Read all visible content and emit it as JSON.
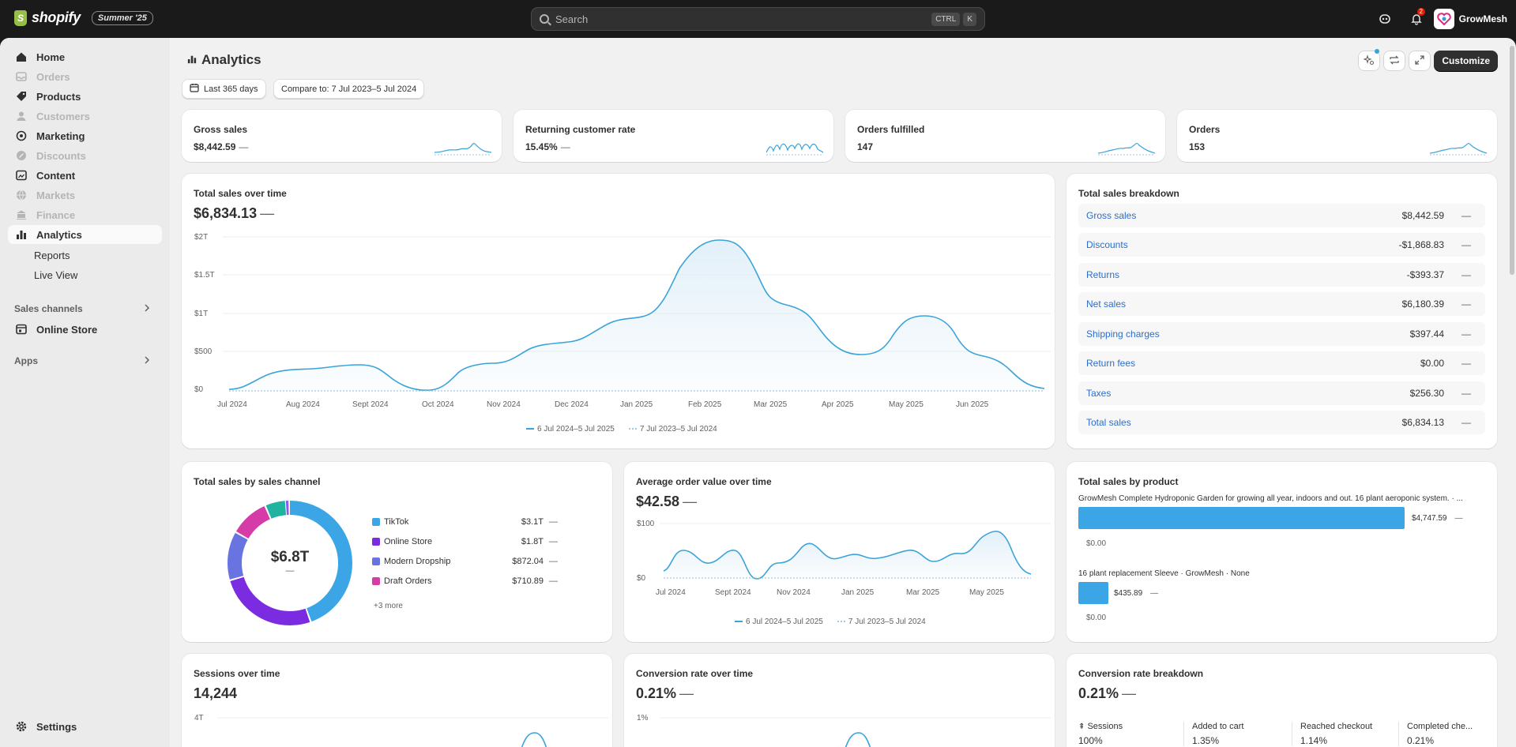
{
  "topbar": {
    "brand": "shopify",
    "edition": "Summer '25",
    "search_placeholder": "Search",
    "shortcut_ctrl": "CTRL",
    "shortcut_key": "K",
    "notifications_count": "2",
    "store_name": "GrowMesh"
  },
  "sidebar": {
    "items": [
      {
        "label": "Home",
        "icon": "home-icon",
        "enabled": true
      },
      {
        "label": "Orders",
        "icon": "orders-icon",
        "enabled": false
      },
      {
        "label": "Products",
        "icon": "tag-icon",
        "enabled": true
      },
      {
        "label": "Customers",
        "icon": "person-icon",
        "enabled": false
      },
      {
        "label": "Marketing",
        "icon": "target-icon",
        "enabled": true
      },
      {
        "label": "Discounts",
        "icon": "discount-icon",
        "enabled": false
      },
      {
        "label": "Content",
        "icon": "content-icon",
        "enabled": true
      },
      {
        "label": "Markets",
        "icon": "globe-icon",
        "enabled": false
      },
      {
        "label": "Finance",
        "icon": "bank-icon",
        "enabled": false
      },
      {
        "label": "Analytics",
        "icon": "chart-icon",
        "enabled": true
      }
    ],
    "sub_items": [
      "Reports",
      "Live View"
    ],
    "sales_channels_label": "Sales channels",
    "online_store_label": "Online Store",
    "apps_label": "Apps",
    "settings_label": "Settings"
  },
  "header": {
    "title": "Analytics",
    "date_range": "Last 365 days",
    "compare": "Compare to: 7 Jul 2023–5 Jul 2024",
    "customize_label": "Customize"
  },
  "kpis": [
    {
      "title": "Gross sales",
      "value": "$8,442.59",
      "delta": "—"
    },
    {
      "title": "Returning customer rate",
      "value": "15.45%",
      "delta": "—"
    },
    {
      "title": "Orders fulfilled",
      "value": "147",
      "delta": "—"
    },
    {
      "title": "Orders",
      "value": "153",
      "delta": "—"
    }
  ],
  "total_sales_over_time": {
    "title": "Total sales over time",
    "value": "$6,834.13",
    "delta": "—",
    "legend_current": "6 Jul 2024–5 Jul 2025",
    "legend_previous": "7 Jul 2023–5 Jul 2024",
    "y_ticks": [
      "$2T",
      "$1.5T",
      "$1T",
      "$500",
      "$0"
    ],
    "x_ticks": [
      "Jul 2024",
      "Aug 2024",
      "Sept 2024",
      "Oct 2024",
      "Nov 2024",
      "Dec 2024",
      "Jan 2025",
      "Feb 2025",
      "Mar 2025",
      "Apr 2025",
      "May 2025",
      "Jun 2025"
    ]
  },
  "breakdown": {
    "title": "Total sales breakdown",
    "rows": [
      {
        "label": "Gross sales",
        "value": "$8,442.59",
        "delta": "—"
      },
      {
        "label": "Discounts",
        "value": "-$1,868.83",
        "delta": "—"
      },
      {
        "label": "Returns",
        "value": "-$393.37",
        "delta": "—"
      },
      {
        "label": "Net sales",
        "value": "$6,180.39",
        "delta": "—"
      },
      {
        "label": "Shipping charges",
        "value": "$397.44",
        "delta": "—"
      },
      {
        "label": "Return fees",
        "value": "$0.00",
        "delta": "—"
      },
      {
        "label": "Taxes",
        "value": "$256.30",
        "delta": "—"
      },
      {
        "label": "Total sales",
        "value": "$6,834.13",
        "delta": "—"
      }
    ]
  },
  "sales_by_channel": {
    "title": "Total sales by sales channel",
    "center_value": "$6.8T",
    "center_delta": "—",
    "more_label": "+3 more",
    "channels": [
      {
        "name": "TikTok",
        "value": "$3.1T",
        "delta": "—",
        "color": "#3ba5e5"
      },
      {
        "name": "Online Store",
        "value": "$1.8T",
        "delta": "—",
        "color": "#7b2be0"
      },
      {
        "name": "Modern Dropship",
        "value": "$872.04",
        "delta": "—",
        "color": "#6a74e0"
      },
      {
        "name": "Draft Orders",
        "value": "$710.89",
        "delta": "—",
        "color": "#d63ca8"
      }
    ]
  },
  "avg_order_value": {
    "title": "Average order value over time",
    "value": "$42.58",
    "delta": "—",
    "y_ticks": [
      "$100",
      "$0"
    ],
    "x_ticks": [
      "Jul 2024",
      "Sept 2024",
      "Nov 2024",
      "Jan 2025",
      "Mar 2025",
      "May 2025"
    ],
    "legend_current": "6 Jul 2024–5 Jul 2025",
    "legend_previous": "7 Jul 2023–5 Jul 2024"
  },
  "sales_by_product": {
    "title": "Total sales by product",
    "products": [
      {
        "name": "GrowMesh Complete Hydroponic Garden for growing all year, indoors and out. 16 plant aeroponic system. · ...",
        "value": "$4,747.59",
        "delta": "—",
        "prev": "$0.00",
        "fraction": 1.0
      },
      {
        "name": "16 plant replacement Sleeve · GrowMesh · None",
        "value": "$435.89",
        "delta": "—",
        "prev": "$0.00",
        "fraction": 0.092
      }
    ]
  },
  "sessions": {
    "title": "Sessions over time",
    "value": "14,244",
    "y_tick_top": "4T"
  },
  "conversion_over_time": {
    "title": "Conversion rate over time",
    "value": "0.21%",
    "delta": "—",
    "y_tick_top": "1%"
  },
  "conversion_breakdown": {
    "title": "Conversion rate breakdown",
    "value": "0.21%",
    "delta": "—",
    "steps": [
      {
        "label": "Sessions",
        "value": "100%"
      },
      {
        "label": "Added to cart",
        "value": "1.35%"
      },
      {
        "label": "Reached checkout",
        "value": "1.14%"
      },
      {
        "label": "Completed che...",
        "value": "0.21%"
      }
    ]
  }
}
